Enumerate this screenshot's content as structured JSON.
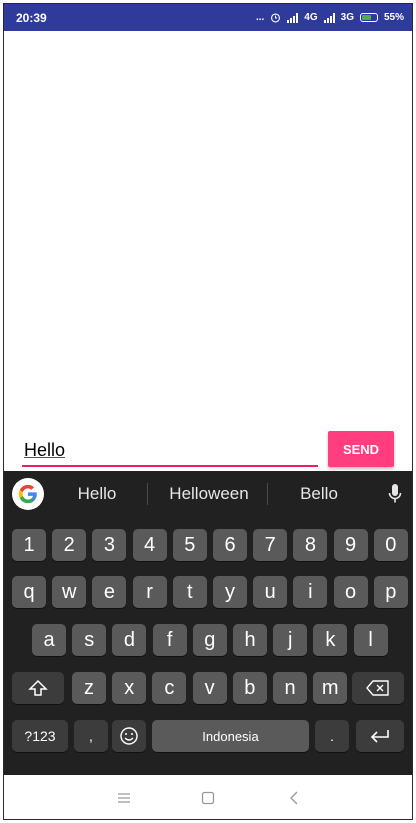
{
  "status_bar": {
    "time": "20:39",
    "dots": "...",
    "net_4g": "4G",
    "net_3g": "3G",
    "battery": "55%"
  },
  "composer": {
    "input_value": "Hello",
    "send_label": "SEND"
  },
  "keyboard": {
    "suggestions": [
      "Hello",
      "Helloween",
      "Bello"
    ],
    "row_numbers": [
      "1",
      "2",
      "3",
      "4",
      "5",
      "6",
      "7",
      "8",
      "9",
      "0"
    ],
    "row_top": [
      "q",
      "w",
      "e",
      "r",
      "t",
      "y",
      "u",
      "i",
      "o",
      "p"
    ],
    "row_middle": [
      "a",
      "s",
      "d",
      "f",
      "g",
      "h",
      "j",
      "k",
      "l"
    ],
    "row_bottom": [
      "z",
      "x",
      "c",
      "v",
      "b",
      "n",
      "m"
    ],
    "symbols_label": "?123",
    "comma_label": ",",
    "space_label": "Indonesia",
    "period_label": "."
  },
  "colors": {
    "status_bar": "#2e3b9a",
    "accent": "#ff3d7f",
    "underline": "#e91e63",
    "keyboard_bg": "#212121",
    "key_bg": "#5a5a5a"
  }
}
